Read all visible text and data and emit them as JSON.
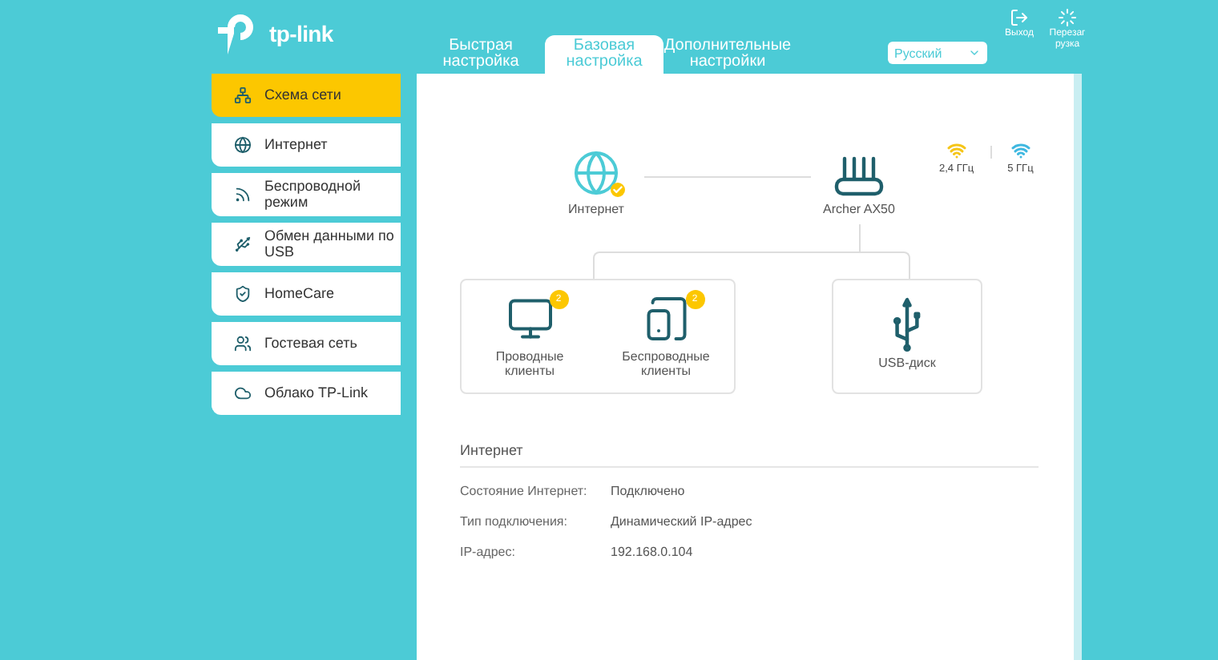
{
  "logo": {
    "text": "tp-link"
  },
  "tabs": [
    {
      "label": "Быстрая настройка",
      "selected": false
    },
    {
      "label": "Базовая настройка",
      "selected": true
    },
    {
      "label": "Дополнительные настройки",
      "selected": false
    }
  ],
  "language": {
    "value": "Русский"
  },
  "header_actions": [
    {
      "label": "Выход"
    },
    {
      "label": "Перезагрузка"
    }
  ],
  "sidebar": {
    "items": [
      {
        "label": "Схема сети",
        "selected": true
      },
      {
        "label": "Интернет",
        "selected": false
      },
      {
        "label": "Беспроводной режим",
        "selected": false
      },
      {
        "label": "Обмен данными по USB",
        "selected": false
      },
      {
        "label": "HomeCare",
        "selected": false
      },
      {
        "label": "Гостевая сеть",
        "selected": false
      },
      {
        "label": "Облако TP-Link",
        "selected": false
      }
    ]
  },
  "diagram": {
    "internet": {
      "label": "Интернет",
      "connected": true
    },
    "router": {
      "label": "Archer AX50"
    },
    "bands": [
      {
        "label": "2,4 ГГц",
        "color": "#f5c518"
      },
      {
        "label": "5 ГГц",
        "color": "#3fb8e0"
      }
    ],
    "clients": [
      {
        "label": "Проводные клиенты",
        "count": "2"
      },
      {
        "label": "Беспроводные клиенты",
        "count": "2"
      }
    ],
    "usb": {
      "label": "USB-диск"
    }
  },
  "info": {
    "title": "Интернет",
    "rows": [
      {
        "label": "Состояние Интернет:",
        "value": "Подключено"
      },
      {
        "label": "Тип подключения:",
        "value": "Динамический IP-адрес"
      },
      {
        "label": "IP-адрес:",
        "value": "192.168.0.104"
      }
    ]
  }
}
